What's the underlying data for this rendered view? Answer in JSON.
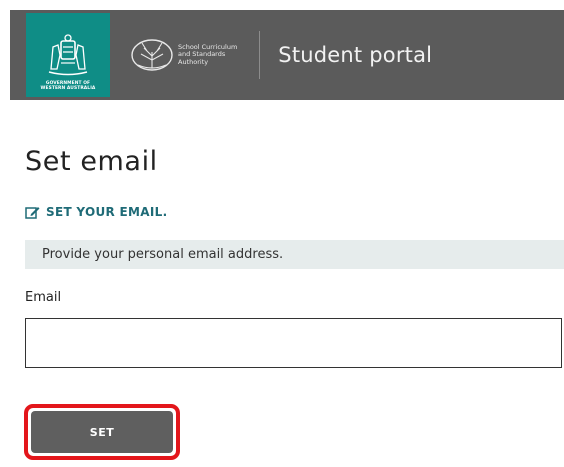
{
  "header": {
    "gov_logo_caption_line1": "GOVERNMENT OF",
    "gov_logo_caption_line2": "WESTERN AUSTRALIA",
    "scsa_line1": "School Curriculum",
    "scsa_line2": "and Standards",
    "scsa_line3": "Authority",
    "portal_title": "Student portal",
    "header_color": "#5b5b5b",
    "logo_color": "#0f8d86"
  },
  "main": {
    "page_title": "Set email",
    "section_heading": "SET YOUR EMAIL.",
    "section_icon": "edit-icon",
    "info_text": "Provide your personal email address.",
    "email_label": "Email",
    "email_value": "",
    "email_placeholder": "",
    "set_button_label": "SET",
    "accent_color": "#1f6b77",
    "highlight_color": "#e3161b"
  }
}
